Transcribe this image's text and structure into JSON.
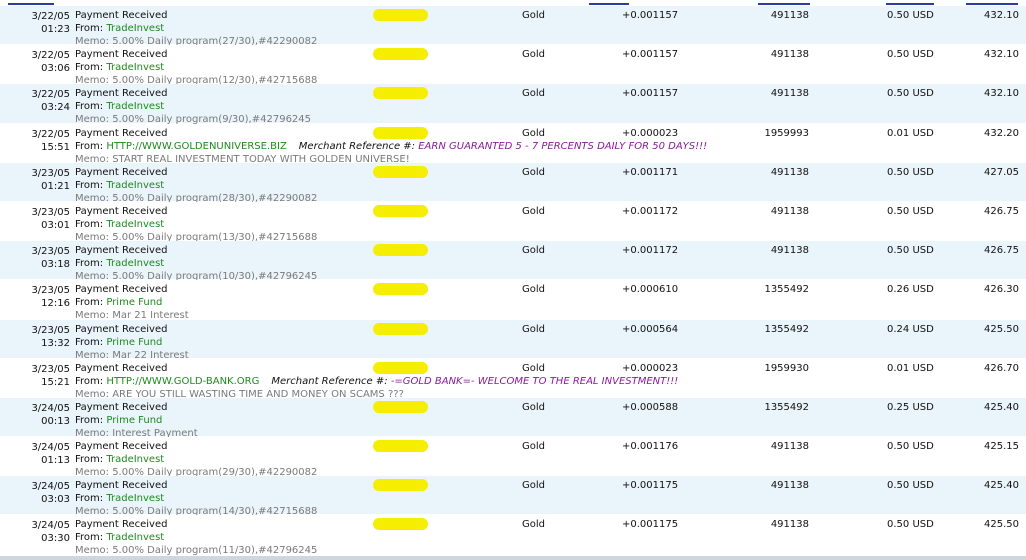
{
  "rows": [
    {
      "date": "3/22/05",
      "time": "01:23",
      "type": "Payment Received",
      "from_label": "From:",
      "from": "TradeInvest",
      "merchant": "",
      "merchant_msg": "",
      "memo": "Memo: 5.00% Daily program(27/30),#42290082",
      "currency": "Gold",
      "amount": "+0.001157",
      "account": "491138",
      "fee": "0.50 USD",
      "balance": "432.10"
    },
    {
      "date": "3/22/05",
      "time": "03:06",
      "type": "Payment Received",
      "from_label": "From:",
      "from": "TradeInvest",
      "merchant": "",
      "merchant_msg": "",
      "memo": "Memo: 5.00% Daily program(12/30),#42715688",
      "currency": "Gold",
      "amount": "+0.001157",
      "account": "491138",
      "fee": "0.50 USD",
      "balance": "432.10"
    },
    {
      "date": "3/22/05",
      "time": "03:24",
      "type": "Payment Received",
      "from_label": "From:",
      "from": "TradeInvest",
      "merchant": "",
      "merchant_msg": "",
      "memo": "Memo: 5.00% Daily program(9/30),#42796245",
      "currency": "Gold",
      "amount": "+0.001157",
      "account": "491138",
      "fee": "0.50 USD",
      "balance": "432.10"
    },
    {
      "date": "3/22/05",
      "time": "15:51",
      "type": "Payment Received",
      "from_label": "From:",
      "from": "HTTP://WWW.GOLDENUNIVERSE.BIZ",
      "merchant": "Merchant Reference #:",
      "merchant_msg": "EARN GUARANTED 5 - 7 PERCENTS DAILY FOR 50 DAYS!!!",
      "memo": "Memo: START REAL INVESTMENT TODAY WITH GOLDEN UNIVERSE!",
      "currency": "Gold",
      "amount": "+0.000023",
      "account": "1959993",
      "fee": "0.01 USD",
      "balance": "432.20"
    },
    {
      "date": "3/23/05",
      "time": "01:21",
      "type": "Payment Received",
      "from_label": "From:",
      "from": "TradeInvest",
      "merchant": "",
      "merchant_msg": "",
      "memo": "Memo: 5.00% Daily program(28/30),#42290082",
      "currency": "Gold",
      "amount": "+0.001171",
      "account": "491138",
      "fee": "0.50 USD",
      "balance": "427.05"
    },
    {
      "date": "3/23/05",
      "time": "03:01",
      "type": "Payment Received",
      "from_label": "From:",
      "from": "TradeInvest",
      "merchant": "",
      "merchant_msg": "",
      "memo": "Memo: 5.00% Daily program(13/30),#42715688",
      "currency": "Gold",
      "amount": "+0.001172",
      "account": "491138",
      "fee": "0.50 USD",
      "balance": "426.75"
    },
    {
      "date": "3/23/05",
      "time": "03:18",
      "type": "Payment Received",
      "from_label": "From:",
      "from": "TradeInvest",
      "merchant": "",
      "merchant_msg": "",
      "memo": "Memo: 5.00% Daily program(10/30),#42796245",
      "currency": "Gold",
      "amount": "+0.001172",
      "account": "491138",
      "fee": "0.50 USD",
      "balance": "426.75"
    },
    {
      "date": "3/23/05",
      "time": "12:16",
      "type": "Payment Received",
      "from_label": "From:",
      "from": "Prime Fund",
      "merchant": "",
      "merchant_msg": "",
      "memo": "Memo: Mar 21 Interest",
      "currency": "Gold",
      "amount": "+0.000610",
      "account": "1355492",
      "fee": "0.26 USD",
      "balance": "426.30"
    },
    {
      "date": "3/23/05",
      "time": "13:32",
      "type": "Payment Received",
      "from_label": "From:",
      "from": "Prime Fund",
      "merchant": "",
      "merchant_msg": "",
      "memo": "Memo: Mar 22 Interest",
      "currency": "Gold",
      "amount": "+0.000564",
      "account": "1355492",
      "fee": "0.24 USD",
      "balance": "425.50"
    },
    {
      "date": "3/23/05",
      "time": "15:21",
      "type": "Payment Received",
      "from_label": "From:",
      "from": "HTTP://WWW.GOLD-BANK.ORG",
      "merchant": "Merchant Reference #:",
      "merchant_msg": "-=GOLD BANK=- WELCOME TO THE REAL INVESTMENT!!!",
      "memo": "Memo: ARE YOU STILL WASTING TIME AND MONEY ON SCAMS ???",
      "currency": "Gold",
      "amount": "+0.000023",
      "account": "1959930",
      "fee": "0.01 USD",
      "balance": "426.70"
    },
    {
      "date": "3/24/05",
      "time": "00:13",
      "type": "Payment Received",
      "from_label": "From:",
      "from": "Prime Fund",
      "merchant": "",
      "merchant_msg": "",
      "memo": "Memo: Interest Payment",
      "currency": "Gold",
      "amount": "+0.000588",
      "account": "1355492",
      "fee": "0.25 USD",
      "balance": "425.40"
    },
    {
      "date": "3/24/05",
      "time": "01:13",
      "type": "Payment Received",
      "from_label": "From:",
      "from": "TradeInvest",
      "merchant": "",
      "merchant_msg": "",
      "memo": "Memo: 5.00% Daily program(29/30),#42290082",
      "currency": "Gold",
      "amount": "+0.001176",
      "account": "491138",
      "fee": "0.50 USD",
      "balance": "425.15"
    },
    {
      "date": "3/24/05",
      "time": "03:03",
      "type": "Payment Received",
      "from_label": "From:",
      "from": "TradeInvest",
      "merchant": "",
      "merchant_msg": "",
      "memo": "Memo: 5.00% Daily program(14/30),#42715688",
      "currency": "Gold",
      "amount": "+0.001175",
      "account": "491138",
      "fee": "0.50 USD",
      "balance": "425.40"
    },
    {
      "date": "3/24/05",
      "time": "03:30",
      "type": "Payment Received",
      "from_label": "From:",
      "from": "TradeInvest",
      "merchant": "",
      "merchant_msg": "",
      "memo": "Memo: 5.00% Daily program(11/30),#42796245",
      "currency": "Gold",
      "amount": "+0.001175",
      "account": "491138",
      "fee": "0.50 USD",
      "balance": "425.50"
    }
  ],
  "colors": {
    "row_alt": "#eaf4fb",
    "from_name": "#1d8a1d",
    "merchant_msg": "#8b1a9c",
    "memo": "#7a7a7a",
    "redaction": "#f5ee00",
    "header_rule": "#2a3e9e"
  }
}
